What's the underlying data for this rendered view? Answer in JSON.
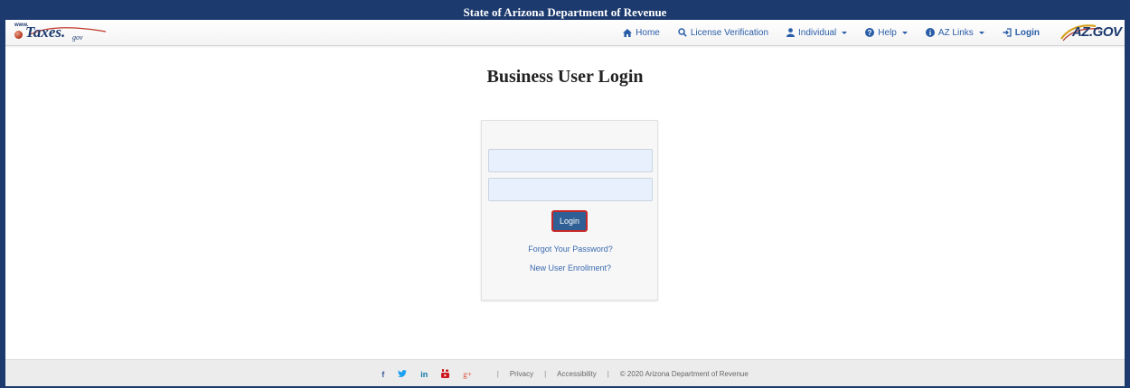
{
  "header": {
    "banner_title": "State of Arizona Department of Revenue"
  },
  "brand": {
    "www": "www.",
    "taxes": "Taxes.",
    "gov": "gov",
    "azgov": "AZ.GOV"
  },
  "nav": {
    "items": [
      {
        "label": "Home",
        "icon": "home-icon"
      },
      {
        "label": "License Verification",
        "icon": "search-icon"
      },
      {
        "label": "Individual",
        "icon": "user-icon",
        "dropdown": true
      },
      {
        "label": "Help",
        "icon": "question-circle-icon",
        "dropdown": true
      },
      {
        "label": "AZ Links",
        "icon": "info-circle-icon",
        "dropdown": true
      },
      {
        "label": "Login",
        "icon": "sign-in-icon"
      }
    ]
  },
  "main": {
    "title": "Business User Login"
  },
  "login": {
    "username_value": "",
    "password_value": "",
    "button_label": "Login",
    "forgot_link": "Forgot Your Password?",
    "enroll_link": "New User Enrollment?"
  },
  "footer": {
    "social": [
      {
        "name": "facebook-icon",
        "glyph": "f",
        "color": "#3b5998"
      },
      {
        "name": "twitter-icon",
        "glyph": "♥",
        "color": "#1da1f2"
      },
      {
        "name": "linkedin-icon",
        "glyph": "in",
        "color": "#0e76a8"
      },
      {
        "name": "youtube-icon",
        "glyph": "▶",
        "color": "#cc181e"
      },
      {
        "name": "google-plus-icon",
        "glyph": "g+",
        "color": "#dd4b39"
      }
    ],
    "separator": "|",
    "privacy": "Privacy",
    "accessibility": "Accessibility",
    "copyright": "© 2020 Arizona Department of Revenue"
  },
  "colors": {
    "banner": "#1c3a6e",
    "nav_link": "#2a5da8",
    "button": "#2f5f94",
    "button_highlight": "#c62828",
    "field_fill": "#e8f0fe"
  }
}
